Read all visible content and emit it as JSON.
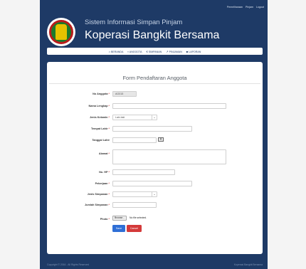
{
  "header": {
    "top_links": [
      "Pemeliharaan",
      "Pinjam",
      "Logout"
    ],
    "subtitle": "Sistem Informasi Simpan Pinjam",
    "title": "Koperasi Bangkit Bersama"
  },
  "nav": [
    {
      "icon": "⌂",
      "label": "BERANDA",
      "icon_name": "home-icon"
    },
    {
      "icon": "▪",
      "label": "ANGGOTA",
      "icon_name": "user-icon"
    },
    {
      "icon": "€",
      "label": "SIMPANAN",
      "icon_name": "euro-icon"
    },
    {
      "icon": "↗",
      "label": "PINJAMAN",
      "icon_name": "transfer-icon"
    },
    {
      "icon": "■",
      "label": "LAPORAN",
      "icon_name": "report-icon"
    }
  ],
  "form": {
    "title": "Form Pendaftaran Anggota",
    "fields": {
      "no_anggota": {
        "label": "No Anggota",
        "value": "AG015"
      },
      "nama": {
        "label": "Nama Lengkap",
        "value": ""
      },
      "jenis_kelamin": {
        "label": "Jenis Kelamin",
        "value": "Laki-laki"
      },
      "tempat_lahir": {
        "label": "Tempat Lahir",
        "value": ""
      },
      "tanggal_lahir": {
        "label": "Tanggal Lahir",
        "value": ""
      },
      "alamat": {
        "label": "Alamat",
        "value": ""
      },
      "no_hp": {
        "label": "No. HP",
        "value": ""
      },
      "pekerjaan": {
        "label": "Pekerjaan",
        "value": ""
      },
      "jenis_simpanan": {
        "label": "Jenis Simpanan",
        "value": ""
      },
      "jumlah_simpanan": {
        "label": "Jumlah Simpanan",
        "value": ""
      },
      "photo": {
        "label": "Photo",
        "button": "Browse...",
        "status": "No file selected."
      }
    },
    "save_label": "Save",
    "cancel_label": "Cancel"
  },
  "footer": {
    "left": "Copyright © 2016 - All Rights Reserved",
    "right": "Koperasi Bangkit Bersama"
  },
  "colors": {
    "accent": "#1e3a66",
    "save": "#2f6fd6",
    "cancel": "#d43a3a"
  }
}
